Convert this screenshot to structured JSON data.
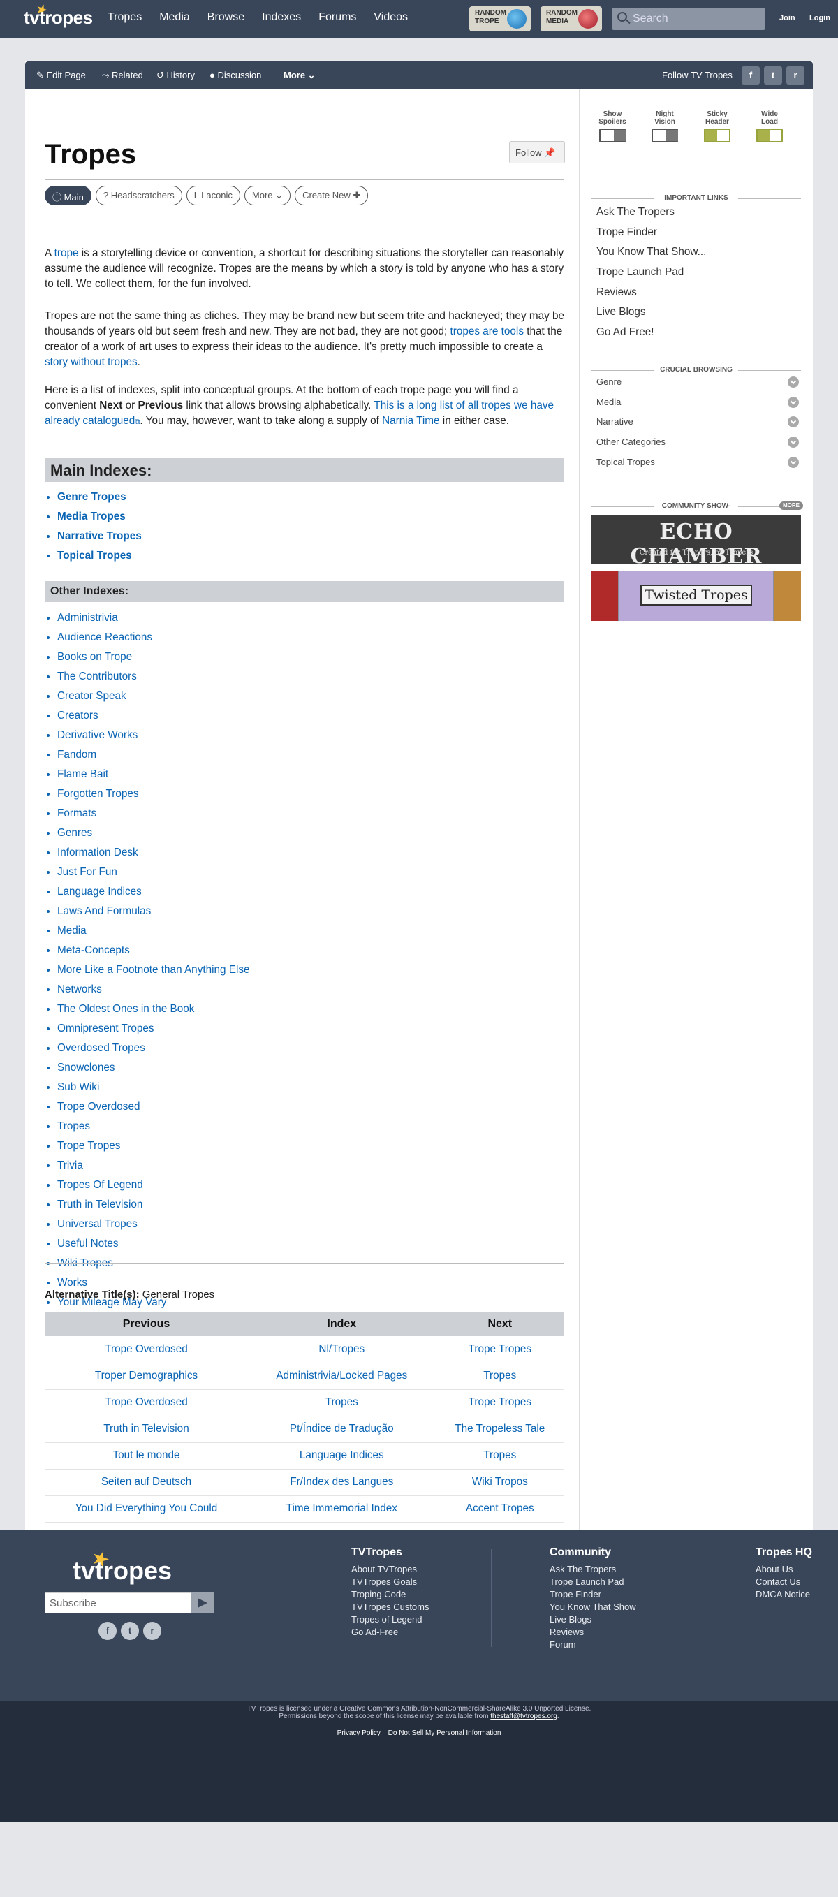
{
  "header": {
    "logo": "tvtropes",
    "nav": [
      "Tropes",
      "Media",
      "Browse",
      "Indexes",
      "Forums",
      "Videos"
    ],
    "random_trope": "RANDOM TROPE",
    "random_media": "RANDOM MEDIA",
    "search_placeholder": "Search",
    "join": "Join",
    "login": "Login"
  },
  "actions": {
    "edit": "✎ Edit Page",
    "related": "⤳ Related",
    "history": "↺ History",
    "discussion": "● Discussion",
    "more": "More ⌄",
    "follow_label": "Follow TV Tropes",
    "social": [
      "f",
      "t",
      "r"
    ]
  },
  "page": {
    "title": "Tropes",
    "follow_button": "Follow",
    "tabs": [
      "Main",
      "Headscratchers",
      "Laconic",
      "More",
      "Create New"
    ],
    "tab_icons": [
      "ⓘ",
      "?",
      "L",
      "⌄",
      "✚"
    ],
    "intro1_a": "A ",
    "intro1_link": "trope",
    "intro1_b": " is a storytelling device or convention, a shortcut for describing situations the storyteller can rea­sonably assume the audience will recognize. Tropes are the means by which a story is told by anyone who has a story to tell. We collect them, for the fun involved.",
    "intro2_a": "Tropes are not the same thing as cliches. They may be brand new but seem trite and hackneyed; they may be thousands of years old but seem fresh and new. They are not bad, they are not good; ",
    "intro2_link": "tropes are tools",
    "intro2_b": " that the creator of a work of art uses to express their ideas to the audience. It's pretty much impos­sible to create a ",
    "intro2_link2": "story without tropes",
    "intro2_c": ".",
    "intro3_a": "Here is a list of indexes, split into conceptual groups. At the bottom of each trope page you will find a convenient ",
    "intro3_next": "Next",
    "intro3_or": " or ",
    "intro3_prev": "Previous",
    "intro3_b": " link that allows browsing alphabetically. ",
    "intro3_link": "This is a long list of all tropes we have already catalogued",
    "intro3_c": ". You may, however, want to take along a supply of ",
    "intro3_link2": "Narnia Time",
    "intro3_d": " in either case.",
    "main_indexes_heading": "Main Indexes:",
    "main_indexes": [
      "Genre Tropes",
      "Media Tropes",
      "Narrative Tropes",
      "Topical Tropes"
    ],
    "other_indexes_heading": "Other Indexes:",
    "other_indexes": [
      "Administrivia",
      "Audience Reactions",
      "Books on Trope",
      "The Contributors",
      "Creator Speak",
      "Creators",
      "Derivative Works",
      "Fandom",
      "Flame Bait",
      "Forgotten Tropes",
      "Formats",
      "Genres",
      "Information Desk",
      "Just For Fun",
      "Language Indices",
      "Laws And Formulas",
      "Media",
      "Meta-Concepts",
      "More Like a Footnote than Anything Else",
      "Networks",
      "The Oldest Ones in the Book",
      "Omnipresent Tropes",
      "Overdosed Tropes",
      "Snowclones",
      "Sub Wiki",
      "Trope Overdosed",
      "Tropes",
      "Trope Tropes",
      "Trivia",
      "Tropes Of Legend",
      "Truth in Television",
      "Universal Tropes",
      "Useful Notes",
      "Wiki Tropes",
      "Works",
      "Your Mileage May Vary"
    ],
    "alt_title_label": "Alternative Title(s):",
    "alt_title_value": " General Tropes",
    "nav_table": {
      "headers": [
        "Previous",
        "Index",
        "Next"
      ],
      "rows": [
        [
          "Trope Overdosed",
          "Nl/Tropes",
          "Trope Tropes"
        ],
        [
          "Troper Demographics",
          "Administrivia/Locked Pages",
          "Tropes"
        ],
        [
          "Trope Overdosed",
          "Tropes",
          "Trope Tropes"
        ],
        [
          "Truth in Television",
          "Pt/Índice de Tradução",
          "The Tropeless Tale"
        ],
        [
          "Tout le monde",
          "Language Indices",
          "Tropes"
        ],
        [
          "Seiten auf Deutsch",
          "Fr/Index des Langues",
          "Wiki Tropos"
        ],
        [
          "You Did Everything You Could",
          "Time Immemorial Index",
          "Accent Tropes"
        ]
      ]
    }
  },
  "sidebar": {
    "toggles": [
      {
        "label1": "Show",
        "label2": "Spoilers",
        "on": false
      },
      {
        "label1": "Night",
        "label2": "Vision",
        "on": false
      },
      {
        "label1": "Sticky",
        "label2": "Header",
        "on": true
      },
      {
        "label1": "Wide",
        "label2": "Load",
        "on": true
      }
    ],
    "important_heading": "Important Links",
    "important_links": [
      "Ask The Tropers",
      "Trope Finder",
      "You Know That Show...",
      "Trope Launch Pad",
      "Reviews",
      "Live Blogs",
      "Go Ad Free!"
    ],
    "crucial_heading": "Crucial Browsing",
    "crucial": [
      "Genre",
      "Media",
      "Narrative",
      "Other Categories",
      "Topical Tropes"
    ],
    "community_heading": "Community Show-",
    "more_badge": "MORE",
    "echo_title": "ECHO CHAMBER",
    "echo_sub": "Created for Tropers, by Tropers",
    "twisted_title": "Twisted Tropes"
  },
  "footer": {
    "logo": "tvtropes",
    "subscribe_placeholder": "Subscribe",
    "social": [
      "f",
      "t",
      "r"
    ],
    "cols": [
      {
        "title": "TVTropes",
        "links": [
          "About TVTropes",
          "TVTropes Goals",
          "Troping Code",
          "TVTropes Customs",
          "Tropes of Legend",
          "Go Ad-Free"
        ]
      },
      {
        "title": "Community",
        "links": [
          "Ask The Tropers",
          "Trope Launch Pad",
          "Trope Finder",
          "You Know That Show",
          "Live Blogs",
          "Reviews",
          "Forum"
        ]
      },
      {
        "title": "Tropes HQ",
        "links": [
          "About Us",
          "Contact Us",
          "DMCA Notice"
        ]
      }
    ],
    "license1": "TVTropes is licensed under a Creative Commons Attribution-NonCommercial-ShareAlike 3.0 Unported License.",
    "license2": "Permissions beyond the scope of this license may be available from ",
    "license_email": "thestaff@tvtropes.org",
    "license_end": ".",
    "privacy": "Privacy Policy",
    "dnsmpi": "Do Not Sell My Personal Information"
  },
  "colors": {
    "nav_bg": "#39465a",
    "link": "#0a64b4",
    "heading_bar": "#cdd1d6",
    "accent_green": "#a9b24a"
  }
}
